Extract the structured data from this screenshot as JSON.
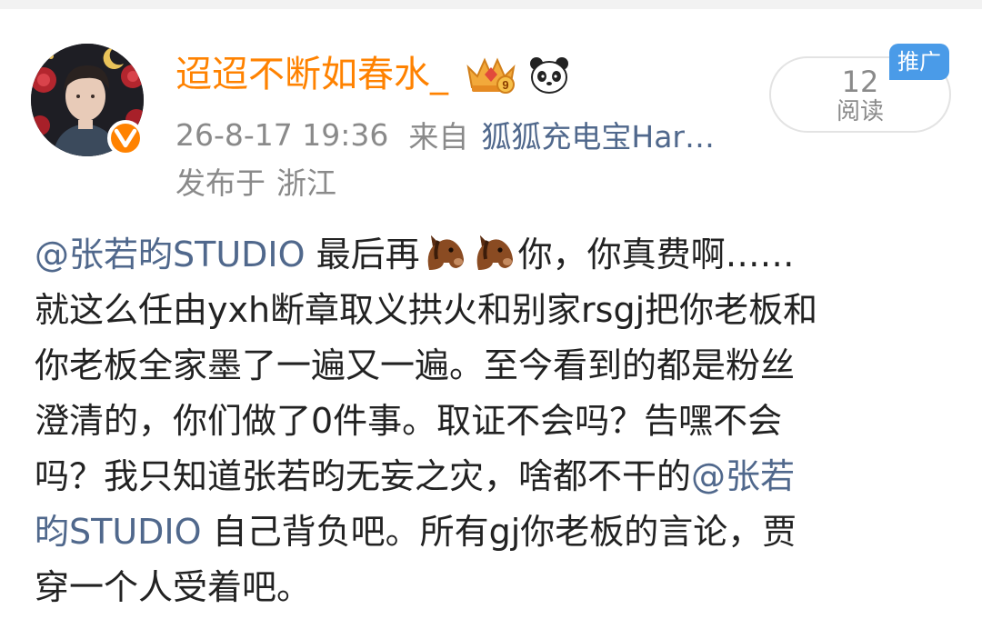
{
  "post": {
    "author": {
      "name": "迢迢不断如春水_",
      "verified_icon": "orange-v-verified-icon",
      "vip_icon": "vip-crown-9-icon",
      "decor_icon": "panda-icon"
    },
    "meta": {
      "time": "26-8-17 19:36",
      "from_label": "来自",
      "source": "狐狐充电宝Har…",
      "location_label": "发布于",
      "location": "浙江"
    },
    "reads": {
      "count": "12",
      "label": "阅读",
      "promo_badge": "推广"
    },
    "body": {
      "mention": "@张若昀STUDIO",
      "l1_a": "最后再",
      "l1_b": "你，你真费啊……",
      "l2": "就这么任由yxh断章取义拱火和别家rsgj把你老板和",
      "l3": "你老板全家墨了一遍又一遍。至今看到的都是粉丝",
      "l4": "澄清的，你们做了0件事。取证不会吗？告嘿不会",
      "l5_a": "吗？我只知道张若昀无妄之灾，啥都不干的",
      "l5_mention": "@张若",
      "l6_mention": "昀STUDIO",
      "l6_b": "自己背负吧。所有gj你老板的言论，贾",
      "l7": "穿一个人受着吧。",
      "emoji_icon": "horse-face-icon"
    },
    "colors": {
      "name": "#ff8200",
      "link": "#50688c",
      "meta": "#8a8a8a",
      "promo": "#4a9be8"
    }
  }
}
